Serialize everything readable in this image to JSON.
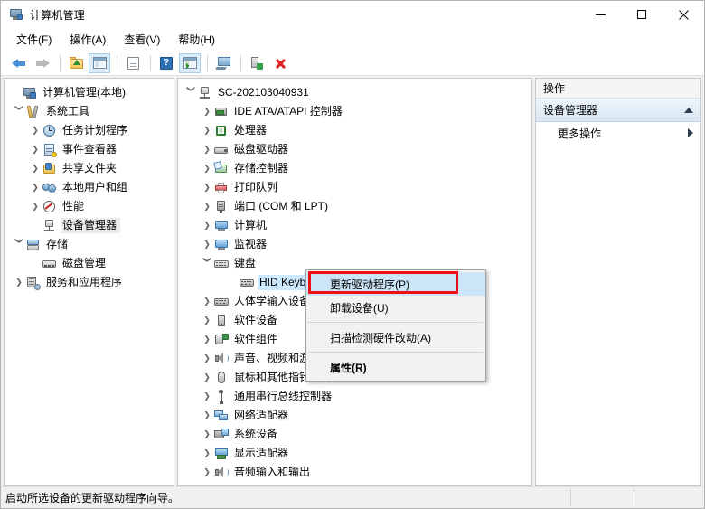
{
  "window": {
    "title": "计算机管理",
    "icon": "computer-management-icon",
    "controls": {
      "minimize": "–",
      "maximize": "□",
      "close": "✕"
    }
  },
  "menubar": [
    {
      "label": "文件(F)",
      "name": "menu-file"
    },
    {
      "label": "操作(A)",
      "name": "menu-action"
    },
    {
      "label": "查看(V)",
      "name": "menu-view"
    },
    {
      "label": "帮助(H)",
      "name": "menu-help"
    }
  ],
  "toolbar": [
    {
      "name": "back-button",
      "icon": "back-arrow-icon"
    },
    {
      "name": "forward-button",
      "icon": "forward-arrow-icon"
    },
    {
      "name": "up-folder-button",
      "icon": "folder-up-icon"
    },
    {
      "name": "show-hide-tree-button",
      "icon": "tree-pane-icon"
    },
    {
      "name": "properties-button",
      "icon": "document-icon"
    },
    {
      "name": "help-button",
      "icon": "question-mark-icon"
    },
    {
      "name": "show-action-pane-button",
      "icon": "action-pane-icon"
    },
    {
      "name": "scan-hardware-button",
      "icon": "monitor-icon"
    },
    {
      "name": "update-driver-button",
      "icon": "device-update-icon"
    },
    {
      "name": "uninstall-device-button",
      "icon": "red-x-icon"
    }
  ],
  "sidebar": {
    "items": [
      {
        "label": "计算机管理(本地)",
        "icon": "computer-icon",
        "indent": 0,
        "twisty": "",
        "selected": false
      },
      {
        "label": "系统工具",
        "icon": "tools-icon",
        "indent": 1,
        "twisty": "expanded",
        "selected": false
      },
      {
        "label": "任务计划程序",
        "icon": "clock-icon",
        "indent": 2,
        "twisty": "collapsed",
        "selected": false
      },
      {
        "label": "事件查看器",
        "icon": "event-viewer-icon",
        "indent": 2,
        "twisty": "collapsed",
        "selected": false
      },
      {
        "label": "共享文件夹",
        "icon": "shared-folder-icon",
        "indent": 2,
        "twisty": "collapsed",
        "selected": false
      },
      {
        "label": "本地用户和组",
        "icon": "users-icon",
        "indent": 2,
        "twisty": "collapsed",
        "selected": false
      },
      {
        "label": "性能",
        "icon": "performance-icon",
        "indent": 2,
        "twisty": "collapsed",
        "selected": false
      },
      {
        "label": "设备管理器",
        "icon": "device-manager-icon",
        "indent": 2,
        "twisty": "",
        "selected": true
      },
      {
        "label": "存储",
        "icon": "storage-icon",
        "indent": 1,
        "twisty": "expanded",
        "selected": false
      },
      {
        "label": "磁盘管理",
        "icon": "disk-management-icon",
        "indent": 2,
        "twisty": "",
        "selected": false
      },
      {
        "label": "服务和应用程序",
        "icon": "services-icon",
        "indent": 1,
        "twisty": "collapsed",
        "selected": false
      }
    ]
  },
  "device_tree": {
    "items": [
      {
        "label": "SC-202103040931",
        "icon": "computer-node-icon",
        "indent": 0,
        "twisty": "expanded",
        "selected": false
      },
      {
        "label": "IDE ATA/ATAPI 控制器",
        "icon": "ide-controller-icon",
        "indent": 1,
        "twisty": "collapsed",
        "selected": false
      },
      {
        "label": "处理器",
        "icon": "processor-icon",
        "indent": 1,
        "twisty": "collapsed",
        "selected": false
      },
      {
        "label": "磁盘驱动器",
        "icon": "disk-drive-icon",
        "indent": 1,
        "twisty": "collapsed",
        "selected": false
      },
      {
        "label": "存储控制器",
        "icon": "storage-controller-icon",
        "indent": 1,
        "twisty": "collapsed",
        "selected": false
      },
      {
        "label": "打印队列",
        "icon": "print-queue-icon",
        "indent": 1,
        "twisty": "collapsed",
        "selected": false
      },
      {
        "label": "端口 (COM 和 LPT)",
        "icon": "port-icon",
        "indent": 1,
        "twisty": "collapsed",
        "selected": false
      },
      {
        "label": "计算机",
        "icon": "computer-monitor-icon",
        "indent": 1,
        "twisty": "collapsed",
        "selected": false
      },
      {
        "label": "监视器",
        "icon": "monitor-device-icon",
        "indent": 1,
        "twisty": "collapsed",
        "selected": false
      },
      {
        "label": "键盘",
        "icon": "keyboard-icon",
        "indent": 1,
        "twisty": "expanded",
        "selected": false
      },
      {
        "label": "HID Keyboard Device",
        "icon": "hid-keyboard-icon",
        "indent": 2,
        "twisty": "",
        "selected": true
      },
      {
        "label": "人体学输入设备",
        "icon": "hid-device-icon",
        "indent": 1,
        "twisty": "collapsed",
        "selected": false
      },
      {
        "label": "软件设备",
        "icon": "software-device-icon",
        "indent": 1,
        "twisty": "collapsed",
        "selected": false
      },
      {
        "label": "软件组件",
        "icon": "software-component-icon",
        "indent": 1,
        "twisty": "collapsed",
        "selected": false
      },
      {
        "label": "声音、视频和游戏控制器",
        "icon": "sound-video-icon",
        "indent": 1,
        "twisty": "collapsed",
        "selected": false
      },
      {
        "label": "鼠标和其他指针设备",
        "icon": "mouse-icon",
        "indent": 1,
        "twisty": "collapsed",
        "selected": false
      },
      {
        "label": "通用串行总线控制器",
        "icon": "usb-controller-icon",
        "indent": 1,
        "twisty": "collapsed",
        "selected": false
      },
      {
        "label": "网络适配器",
        "icon": "network-adapter-icon",
        "indent": 1,
        "twisty": "collapsed",
        "selected": false
      },
      {
        "label": "系统设备",
        "icon": "system-device-icon",
        "indent": 1,
        "twisty": "collapsed",
        "selected": false
      },
      {
        "label": "显示适配器",
        "icon": "display-adapter-icon",
        "indent": 1,
        "twisty": "collapsed",
        "selected": false
      },
      {
        "label": "音频输入和输出",
        "icon": "audio-io-icon",
        "indent": 1,
        "twisty": "collapsed",
        "selected": false
      }
    ]
  },
  "context_menu": {
    "items": [
      {
        "label": "更新驱动程序(P)",
        "highlighted": true,
        "bold": false,
        "name": "ctx-update-driver"
      },
      {
        "label": "卸载设备(U)",
        "highlighted": false,
        "bold": false,
        "name": "ctx-uninstall-device"
      },
      {
        "separator_after": true,
        "label": "扫描检测硬件改动(A)",
        "highlighted": false,
        "bold": false,
        "name": "ctx-scan-hardware"
      },
      {
        "label": "属性(R)",
        "highlighted": false,
        "bold": true,
        "name": "ctx-properties"
      }
    ]
  },
  "actions_pane": {
    "header": "操作",
    "section_title": "设备管理器",
    "items": [
      {
        "label": "更多操作",
        "name": "action-more-actions",
        "has_submenu": true
      }
    ]
  },
  "statusbar": {
    "text": "启动所选设备的更新驱动程序向导。"
  },
  "colors": {
    "selection_blue": "#cce8ff",
    "selection_grey": "#ebebeb",
    "highlight_red": "#ee1111",
    "menu_hover": "#cde6f7",
    "accent_blue": "#4a90d9"
  }
}
